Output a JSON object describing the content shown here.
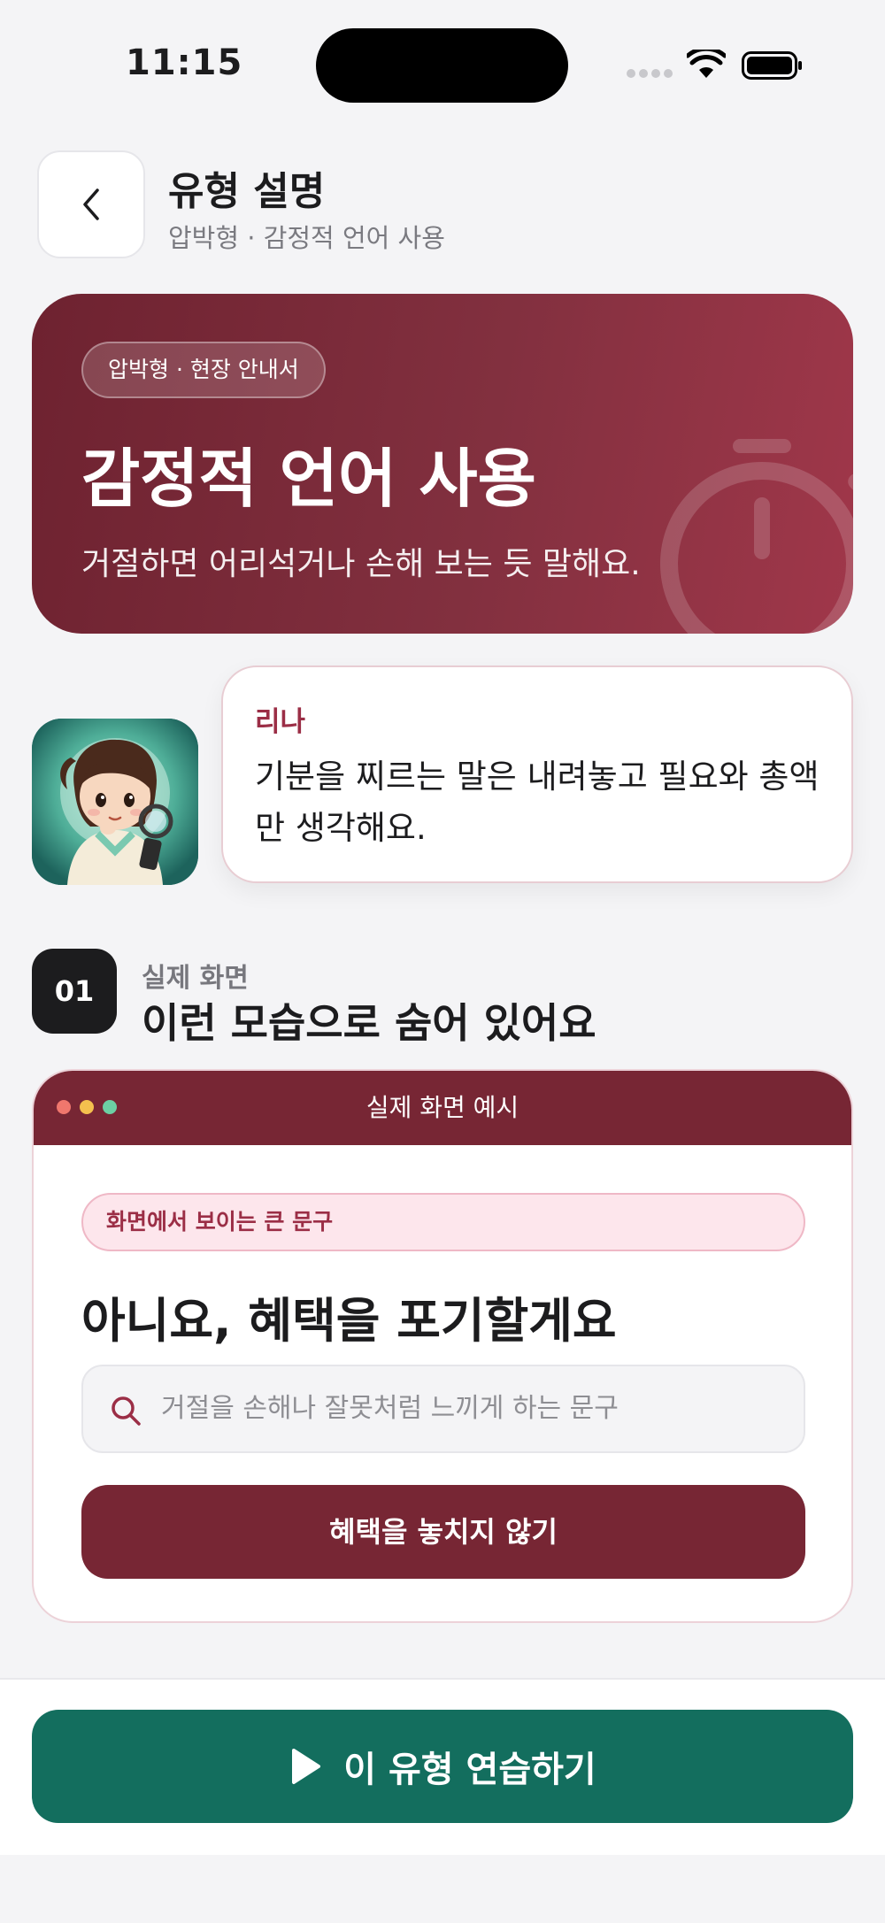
{
  "status_bar": {
    "time": "11:15",
    "icons": [
      "signal-icon",
      "wifi-icon",
      "battery-icon"
    ]
  },
  "header": {
    "back_icon": "chevron-left-icon",
    "title": "유형 설명",
    "subtitle": "압박형 · 감정적 언어 사용"
  },
  "hero": {
    "badge": "압박형 · 현장 안내서",
    "title": "감정적 언어 사용",
    "description": "거절하면 어리석거나 손해 보는 듯 말해요.",
    "decor_icon": "stopwatch-icon",
    "colors": {
      "start": "#6e2230",
      "end": "#a0374a"
    }
  },
  "character": {
    "name": "리나",
    "message": "기분을 찌르는 말은 내려놓고 필요와 총액만 생각해요.",
    "avatar_icon": "character-avatar-with-magnifier"
  },
  "section": {
    "number": "01",
    "kicker": "실제 화면",
    "title": "이런 모습으로 숨어 있어요"
  },
  "example": {
    "bar_title": "실제 화면 예시",
    "tag": "화면에서 보이는 큰 문구",
    "heading": "아니요, 혜택을 포기할게요",
    "search_placeholder": "거절을 손해나 잘못처럼 느끼게 하는 문구",
    "button_label": "혜택을 놓치지 않기",
    "colors": {
      "bar": "#772634",
      "tag_bg": "#fde6ec"
    }
  },
  "cta": {
    "label": "이 유형 연습하기",
    "icon": "play-icon",
    "color": "#136e5e"
  }
}
